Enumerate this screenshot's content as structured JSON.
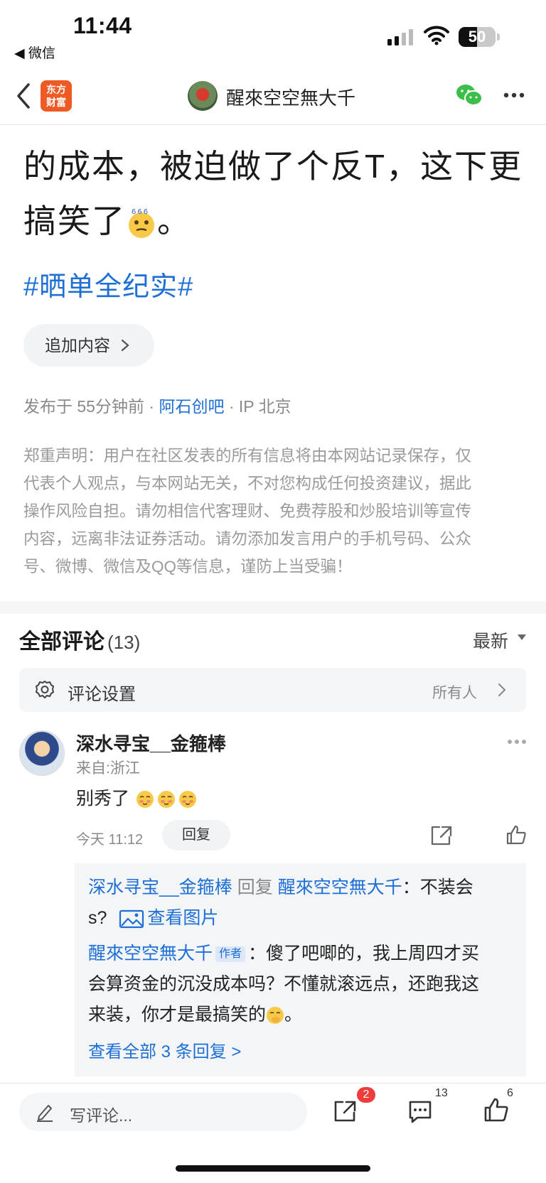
{
  "status_bar": {
    "time": "11:44",
    "back_app": "◀ 微信",
    "battery": "50",
    "battery_level": 0.5
  },
  "nav": {
    "app_logo_text": [
      "东方",
      "财富"
    ],
    "title": "醒來空空無大千"
  },
  "post": {
    "line1": "的成本，被迫做了个反T，这下更",
    "line2_text": "搞笑了",
    "line2_end": "。",
    "hashtag": "#晒单全纪实#",
    "append_button": "追加内容",
    "meta_time": "发布于 55分钟前",
    "meta_sep": "·",
    "meta_forum": "阿石创吧",
    "meta_ip": "IP 北京",
    "disclaimer_lines": [
      "郑重声明：用户在社区发表的所有信息将由本网站记录保存，仅",
      "代表个人观点，与本网站无关，不对您构成任何投资建议，据此",
      "操作风险自担。请勿相信代客理财、免费荐股和炒股培训等宣传",
      "内容，远离非法证券活动。请勿添加发言用户的手机号码、公众",
      "号、微博、微信及QQ等信息，谨防上当受骗！"
    ]
  },
  "comments": {
    "title": "全部评论",
    "count": "(13)",
    "sort": "最新",
    "settings_label": "评论设置",
    "settings_value": "所有人",
    "items": [
      {
        "name": "深水寻宝__金箍棒",
        "from": "来自:浙江",
        "text": "别秀了",
        "time": "今天 11:12",
        "reply_label": "回复",
        "replies": {
          "r1_user": "深水寻宝__金箍棒",
          "r1_mid": "回复",
          "r1_target": "醒來空空無大千",
          "r1_text": "：不装会",
          "r1_text2": "s?",
          "r1_image_link": "查看图片",
          "r2_user": "醒來空空無大千",
          "r2_tag": "作者",
          "r2_text": "：傻了吧唧的，我上周四才买",
          "r2_line2": "会算资金的沉没成本吗？不懂就滚远点，还跑我这",
          "r2_line3": "来装，你才是最搞笑的",
          "r2_end": "。",
          "view_all": "查看全部 3 条回复 >"
        }
      }
    ]
  },
  "bottom_bar": {
    "input_placeholder": "写评论...",
    "share_badge": "2",
    "comment_count": "13",
    "like_count": "6"
  },
  "colors": {
    "link": "#1d6fd6",
    "brand": "#ee5a24",
    "badge": "#ee3b3b",
    "wechat": "#3bbf4a"
  }
}
